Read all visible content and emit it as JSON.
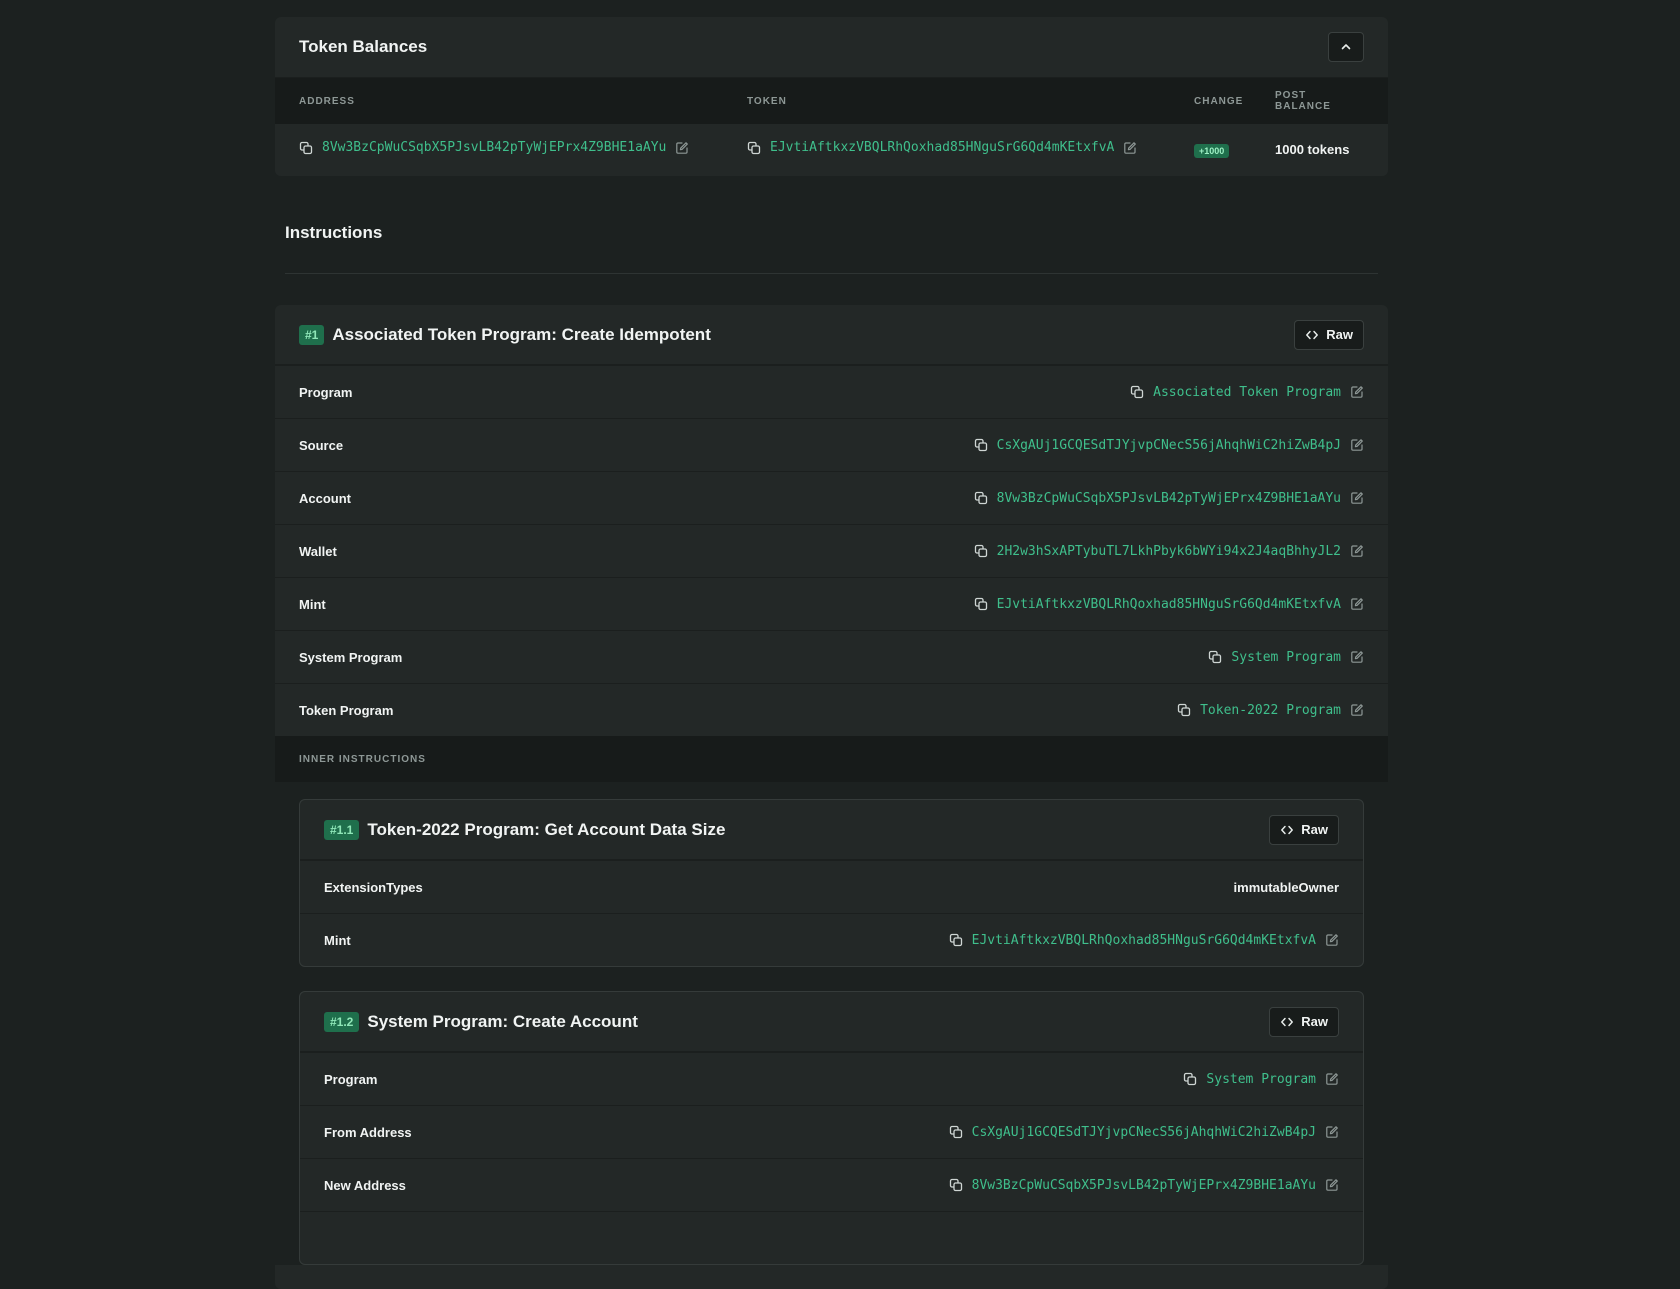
{
  "token_balances": {
    "title": "Token Balances",
    "columns": [
      "ADDRESS",
      "TOKEN",
      "CHANGE",
      "POST BALANCE"
    ],
    "rows": [
      {
        "address": "8Vw3BzCpWuCSqbX5PJsvLB42pTyWjEPrx4Z9BHE1aAYu",
        "token": "EJvtiAftkxzVBQLRhQoxhad85HNguSrG6Qd4mKEtxfvA",
        "change": "+1000",
        "post_balance": "1000 tokens"
      }
    ]
  },
  "instructions": {
    "title": "Instructions",
    "items": [
      {
        "number": "#1",
        "name": "Associated Token Program: Create Idempotent",
        "raw_label": "Raw",
        "params": [
          {
            "label": "Program",
            "value": "Associated Token Program"
          },
          {
            "label": "Source",
            "value": "CsXgAUj1GCQESdTJYjvpCNecS56jAhqhWiC2hiZwB4pJ"
          },
          {
            "label": "Account",
            "value": "8Vw3BzCpWuCSqbX5PJsvLB42pTyWjEPrx4Z9BHE1aAYu"
          },
          {
            "label": "Wallet",
            "value": "2H2w3hSxAPTybuTL7LkhPbyk6bWYi94x2J4aqBhhyJL2"
          },
          {
            "label": "Mint",
            "value": "EJvtiAftkxzVBQLRhQoxhad85HNguSrG6Qd4mKEtxfvA"
          },
          {
            "label": "System Program",
            "value": "System Program"
          },
          {
            "label": "Token Program",
            "value": "Token-2022 Program"
          }
        ],
        "inner_label": "INNER INSTRUCTIONS",
        "inner": [
          {
            "number": "#1.1",
            "name": "Token-2022 Program: Get Account Data Size",
            "raw_label": "Raw",
            "params": [
              {
                "label": "ExtensionTypes",
                "value": "immutableOwner"
              },
              {
                "label": "Mint",
                "value": "EJvtiAftkxzVBQLRhQoxhad85HNguSrG6Qd4mKEtxfvA"
              }
            ]
          },
          {
            "number": "#1.2",
            "name": "System Program: Create Account",
            "raw_label": "Raw",
            "params": [
              {
                "label": "Program",
                "value": "System Program"
              },
              {
                "label": "From Address",
                "value": "CsXgAUj1GCQESdTJYjvpCNecS56jAhqhWiC2hiZwB4pJ"
              },
              {
                "label": "New Address",
                "value": "8Vw3BzCpWuCSqbX5PJsvLB42pTyWjEPrx4Z9BHE1aAYu"
              }
            ]
          }
        ]
      }
    ]
  },
  "colors": {
    "background": "#1c2120",
    "card": "#232827",
    "accent": "#3fbf8c",
    "badge": "#1f6f4c"
  }
}
